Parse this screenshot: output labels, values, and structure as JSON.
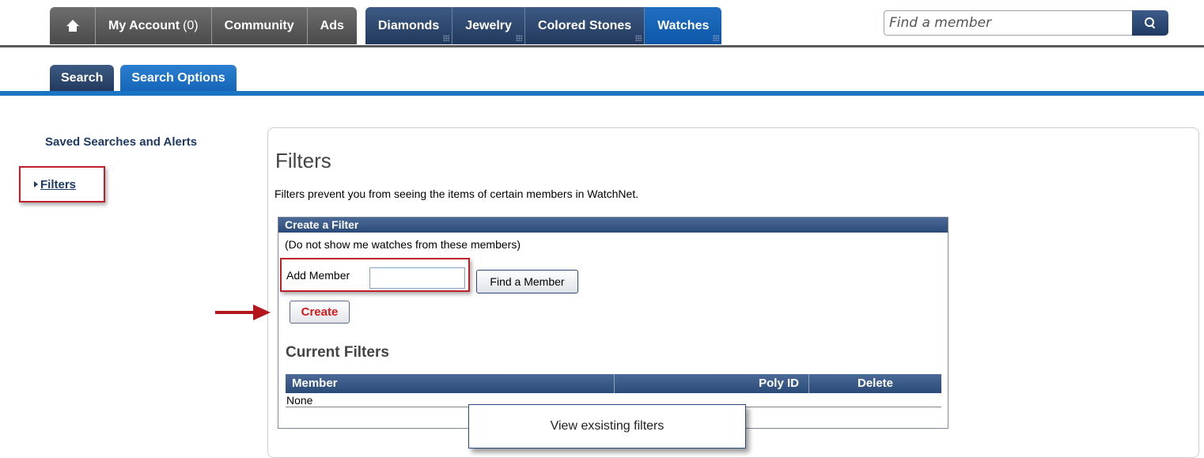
{
  "topnav": {
    "home_icon": "home-icon",
    "tabs": [
      {
        "label": "My Account",
        "count": "(0)"
      },
      {
        "label": "Community"
      },
      {
        "label": "Ads"
      },
      {
        "label": "Diamonds"
      },
      {
        "label": "Jewelry"
      },
      {
        "label": "Colored Stones"
      },
      {
        "label": "Watches"
      }
    ],
    "search": {
      "placeholder": "Find a member",
      "icon": "search-icon"
    }
  },
  "subtabs": [
    "Search",
    "Search Options"
  ],
  "sidebar": {
    "saved_searches": "Saved Searches and Alerts",
    "filters": "Filters"
  },
  "main": {
    "title": "Filters",
    "description": "Filters prevent you from seeing the items of certain members in WatchNet.",
    "create_filter": {
      "header": "Create a Filter",
      "subtitle": "(Do not show me watches from these members)",
      "add_member_label": "Add Member",
      "add_member_value": "",
      "find_button": "Find a Member",
      "create_button": "Create"
    },
    "current_filters": {
      "title": "Current Filters",
      "columns": [
        "Member",
        "Poly ID",
        "Delete"
      ],
      "rows": [
        "None"
      ]
    }
  },
  "annotation": {
    "callout": "View exsisting filters"
  },
  "colors": {
    "nav_gray": "#4a4a4a",
    "nav_blue": "#22395c",
    "active_blue": "#1565b8",
    "highlight_red": "#c0202a",
    "create_red": "#d21b1b"
  }
}
